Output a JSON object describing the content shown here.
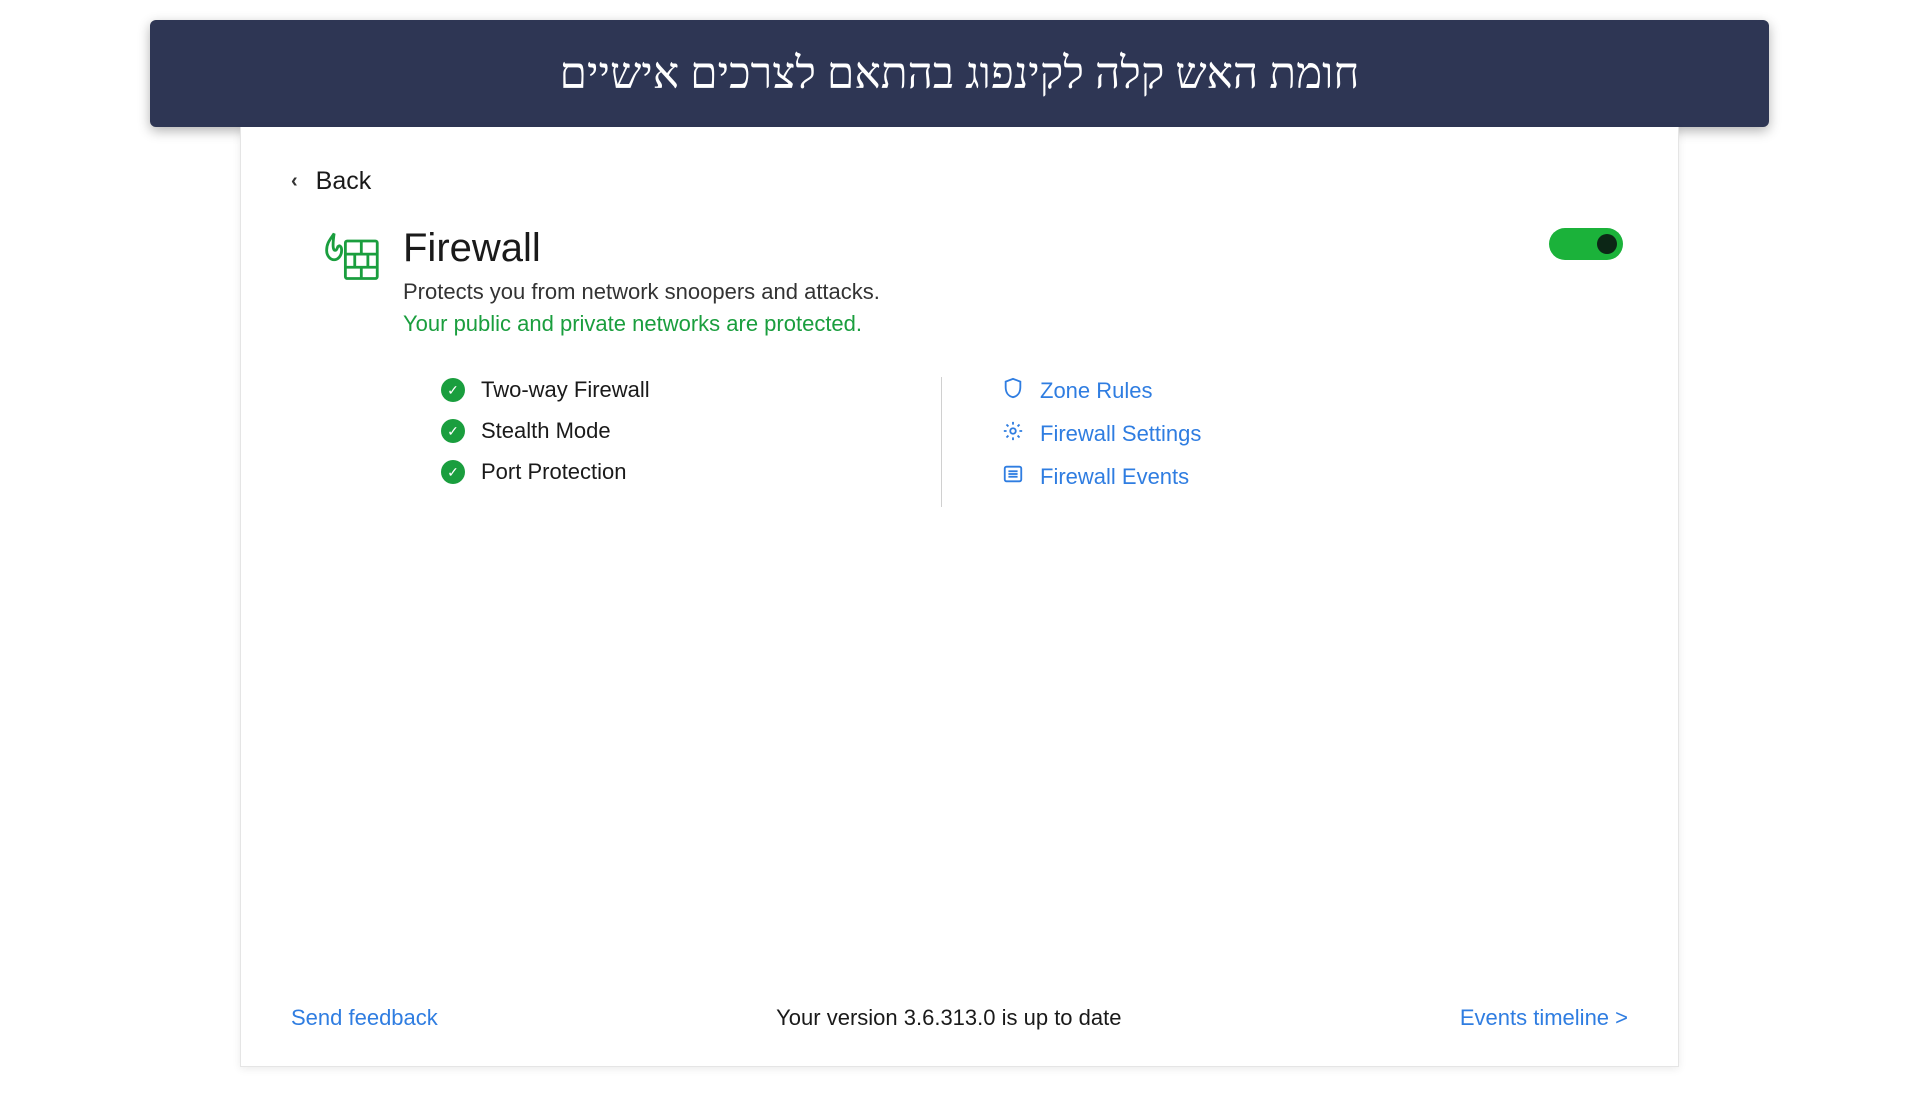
{
  "banner": {
    "text": "חומת האש קלה לקינפוג בהתאם לצרכים אישיים"
  },
  "back": {
    "label": "Back"
  },
  "header": {
    "title": "Firewall",
    "subtitle": "Protects you from network snoopers and attacks.",
    "status": "Your public and private networks are protected."
  },
  "toggle": {
    "on": true
  },
  "features": [
    {
      "label": "Two-way Firewall"
    },
    {
      "label": "Stealth Mode"
    },
    {
      "label": "Port Protection"
    }
  ],
  "links": [
    {
      "label": "Zone Rules",
      "icon": "shield"
    },
    {
      "label": "Firewall Settings",
      "icon": "gear"
    },
    {
      "label": "Firewall Events",
      "icon": "list"
    }
  ],
  "footer": {
    "feedback": "Send feedback",
    "version": "Your version 3.6.313.0 is up to date",
    "events": "Events timeline >"
  },
  "colors": {
    "green": "#1a9e3e",
    "blue": "#2f7de1",
    "bannerBg": "#2e3654"
  }
}
